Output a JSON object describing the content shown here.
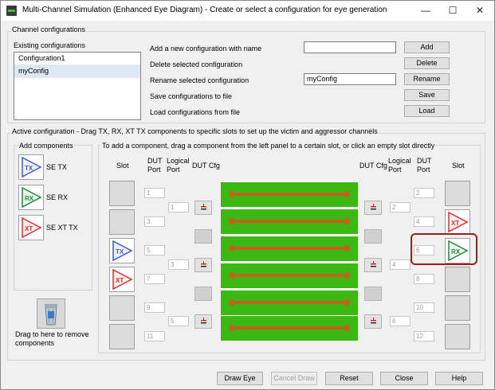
{
  "window": {
    "title": "Multi-Channel Simulation (Enhanced Eye Diagram) - Create or select a configuration for eye generation",
    "controls": {
      "minimize": "—",
      "maximize": "☐",
      "close": "✕"
    }
  },
  "channel_configurations": {
    "group_label": "Channel configurations",
    "existing_label": "Existing configurations",
    "list": [
      "Configuration1",
      "myConfig"
    ],
    "selected_index": 1,
    "actions": {
      "add_label": "Add a new configuration with name",
      "add_value": "",
      "add_button": "Add",
      "delete_label": "Delete selected configuration",
      "delete_button": "Delete",
      "rename_label": "Rename selected configuration",
      "rename_value": "myConfig",
      "rename_button": "Rename",
      "save_label": "Save configurations to file",
      "save_button": "Save",
      "load_label": "Load configurations from file",
      "load_button": "Load"
    }
  },
  "active_configuration": {
    "group_label": "Active configuration - Drag TX, RX, XT TX components to specific slots to set up the victim and aggressor channels",
    "add_components": {
      "group_label": "Add components",
      "items": [
        {
          "icon": "TX",
          "label": "SE TX",
          "color": "#3b5bd6"
        },
        {
          "icon": "RX",
          "label": "SE RX",
          "color": "#1e8a3c"
        },
        {
          "icon": "XT",
          "label": "SE XT TX",
          "color": "#e02b2b"
        }
      ],
      "remove_label": "Drag to here to remove components"
    },
    "slots_panel": {
      "hint": "To add a component, drag a component from the left panel to a certain slot, or click an empty slot directly",
      "left_headers": {
        "slot": "Slot",
        "dut_port": "DUT Port",
        "logical_port": "Logical Port",
        "dut_cfg": "DUT Cfg"
      },
      "right_headers": {
        "dut_cfg": "DUT Cfg",
        "logical_port": "Logical Port",
        "dut_port": "DUT Port",
        "slot": "Slot"
      },
      "left_dut_ports": [
        "1",
        "3",
        "5",
        "7",
        "9",
        "11"
      ],
      "left_logical_ports": [
        "1",
        "3",
        "5"
      ],
      "right_dut_ports": [
        "2",
        "4",
        "6",
        "8",
        "10",
        "12"
      ],
      "right_logical_ports": [
        "2",
        "4",
        "6"
      ],
      "left_slots": [
        "",
        "",
        "TX",
        "XT",
        "",
        ""
      ],
      "right_slots": [
        "",
        "XT",
        "RX",
        "",
        "",
        ""
      ]
    }
  },
  "footer": {
    "draw_eye": "Draw Eye",
    "cancel_draw": "Cancel Draw",
    "reset": "Reset",
    "close": "Close",
    "help": "Help"
  },
  "colors": {
    "trace_green": "#3cb815",
    "trace_copper": "#c0641e",
    "highlight": "#9b1f1f"
  }
}
